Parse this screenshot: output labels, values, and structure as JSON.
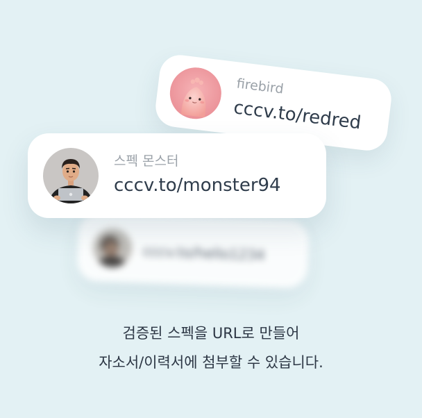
{
  "cards": [
    {
      "nickname": "firebird",
      "url": "cccv.to/redred",
      "avatar_icon": "pink-creature-avatar-icon"
    },
    {
      "nickname": "스펙 몬스터",
      "url": "cccv.to/monster94",
      "avatar_icon": "man-laptop-avatar-icon"
    },
    {
      "nickname": "",
      "url": "cccv.to/hello1234",
      "avatar_icon": "person-avatar-icon"
    }
  ],
  "caption": {
    "line1": "검증된 스펙을 URL로 만들어",
    "line2": "자소서/이력서에 첨부할 수 있습니다."
  },
  "colors": {
    "background": "#e3f1f4",
    "card": "#ffffff",
    "nickname_text": "#9aa1a8",
    "url_text": "#2f3c4b",
    "caption_text": "#2c3644"
  }
}
